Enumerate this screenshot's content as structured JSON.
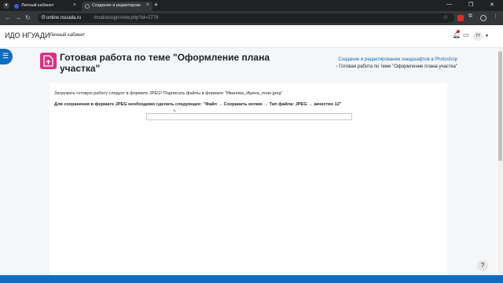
{
  "browser": {
    "tabs": [
      {
        "title": "Личный кабинет",
        "active": false
      },
      {
        "title": "Создание и редактирование ...",
        "active": true
      }
    ],
    "new_tab_glyph": "+",
    "close_glyph": "×",
    "url_host": "online.nsuada.ru",
    "url_path": "/mod/assign/view.php?id=2779",
    "icons": {
      "back": "arrow-left-icon",
      "forward": "arrow-right-icon",
      "reload": "reload-icon",
      "star": "star-icon",
      "extension": "puzzle-icon"
    }
  },
  "navbar": {
    "brand": "ИДО НГУАДИ",
    "link": "Личный кабинет",
    "avatar_initials": "ТТ"
  },
  "page": {
    "title": "Готовая работа по теме \"Оформление плана участка\"",
    "breadcrumb": {
      "course": "Создание и редактирование ландшафтов в Photoshop",
      "separator": "›",
      "current": "Готовая работа по теме \"Оформление плана участка\""
    }
  },
  "assignment": {
    "instruction": "Загружать готовую работу следует в формате JPEG! Подписать файлы в формате \"Иванова_Ирина_план.jpeg\"",
    "save_note": "Для сохранения в формате JPEG необходимо сделать следующее: \"Файл → Сохранить копию → Тип файла: JPEG → качество 12\""
  },
  "help_glyph": "?",
  "colors": {
    "accent": "#0f6cbf",
    "module_icon": "#d63384",
    "notification": "#d93025"
  }
}
